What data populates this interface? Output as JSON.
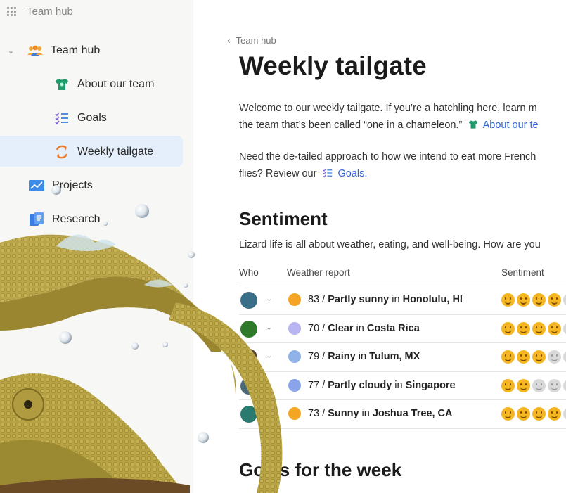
{
  "sidebar": {
    "app_title": "Team hub",
    "section": {
      "label": "Team hub"
    },
    "items": [
      {
        "label": "About our team"
      },
      {
        "label": "Goals"
      },
      {
        "label": "Weekly tailgate"
      },
      {
        "label": "Projects"
      },
      {
        "label": "Research"
      }
    ]
  },
  "page": {
    "breadcrumb": "Team hub",
    "title": "Weekly tailgate",
    "intro_line1": "Welcome to our weekly tailgate. If you’re a hatchling here, learn m",
    "intro_line2_text": "the team that’s been called “one in a chameleon.”",
    "intro_line2_link": "About our te",
    "para2_line1": "Need the de-tailed approach to how we intend to eat more French",
    "para2_line2_text": "flies? Review our",
    "para2_line2_link": "Goals.",
    "sentiment_heading": "Sentiment",
    "sentiment_intro": "Lizard life is all about weather, eating, and well-being. How are you",
    "goals_heading": "Goals for the week"
  },
  "table": {
    "headers": [
      "Who",
      "Weather report",
      "Sentiment"
    ],
    "rows": [
      {
        "temp": "83 / ",
        "condition": "Partly sunny",
        "sep": " in ",
        "place": "Honolulu, HI",
        "avatar_color": "#3a6f8a",
        "dot_color": "#f5a524",
        "sentiment": 4
      },
      {
        "temp": "70 / ",
        "condition": "Clear",
        "sep": " in ",
        "place": "Costa Rica",
        "avatar_color": "#2f7a2a",
        "dot_color": "#b9b4f2",
        "sentiment": 4
      },
      {
        "temp": "79 / ",
        "condition": "Rainy",
        "sep": " in ",
        "place": "Tulum, MX",
        "avatar_color": "#5b4a3a",
        "dot_color": "#8fb3e8",
        "sentiment": 3
      },
      {
        "temp": "77 / ",
        "condition": "Partly cloudy",
        "sep": " in ",
        "place": "Singapore",
        "avatar_color": "#4a6a7a",
        "dot_color": "#8aa4ec",
        "sentiment": 2
      },
      {
        "temp": "73 / ",
        "condition": "Sunny",
        "sep": " in ",
        "place": "Joshua Tree, CA",
        "avatar_color": "#2a7a70",
        "dot_color": "#f5a524",
        "sentiment": 4
      }
    ]
  },
  "colors": {
    "accent": "#2f64d6",
    "sidebar_bg": "#f7f7f5",
    "active_bg": "#e4effb",
    "smile_on": "#f5b623",
    "smile_off": "#d9d9d9"
  }
}
